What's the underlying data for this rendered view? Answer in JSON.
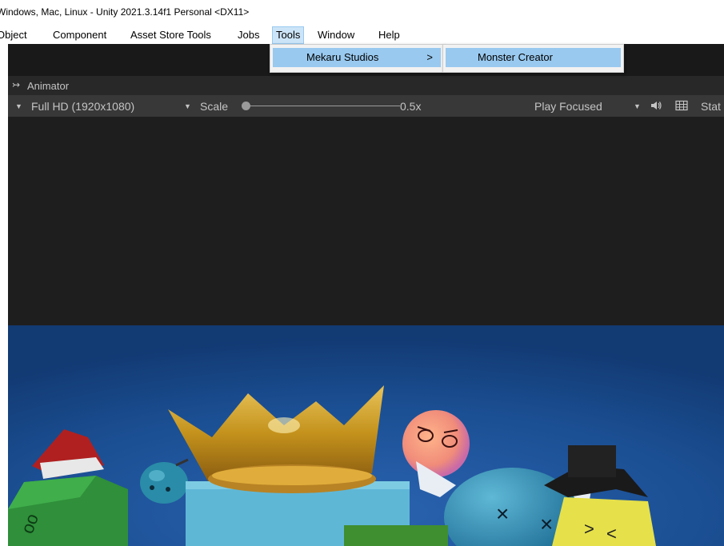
{
  "window": {
    "title": "Windows, Mac, Linux - Unity 2021.3.14f1 Personal <DX11>"
  },
  "menu": {
    "items": [
      {
        "label": "Object"
      },
      {
        "label": "Component"
      },
      {
        "label": "Asset Store Tools"
      },
      {
        "label": "Jobs"
      },
      {
        "label": "Tools",
        "active": true
      },
      {
        "label": "Window"
      },
      {
        "label": "Help"
      }
    ]
  },
  "tools_menu": {
    "item": {
      "label": "Mekaru Studios",
      "arrow": ">"
    },
    "submenu": {
      "item": {
        "label": "Monster Creator"
      }
    }
  },
  "panel": {
    "tab_label": "Animator",
    "tab_icon": "animator-icon"
  },
  "game_toolbar": {
    "resolution": "Full HD (1920x1080)",
    "scale_label": "Scale",
    "scale_value": "0.5x",
    "scale_slider_level": 0,
    "play_mode": "Play Focused",
    "stats_label": "Stat",
    "icons": [
      "mute-audio-icon",
      "keyboard-shortcuts-icon"
    ]
  },
  "colors": {
    "menu_highlight": "#99c9ef",
    "active_menu_bg": "#cce4f7",
    "editor_dark": "#383838",
    "scene_sky": "#1b4f93"
  }
}
